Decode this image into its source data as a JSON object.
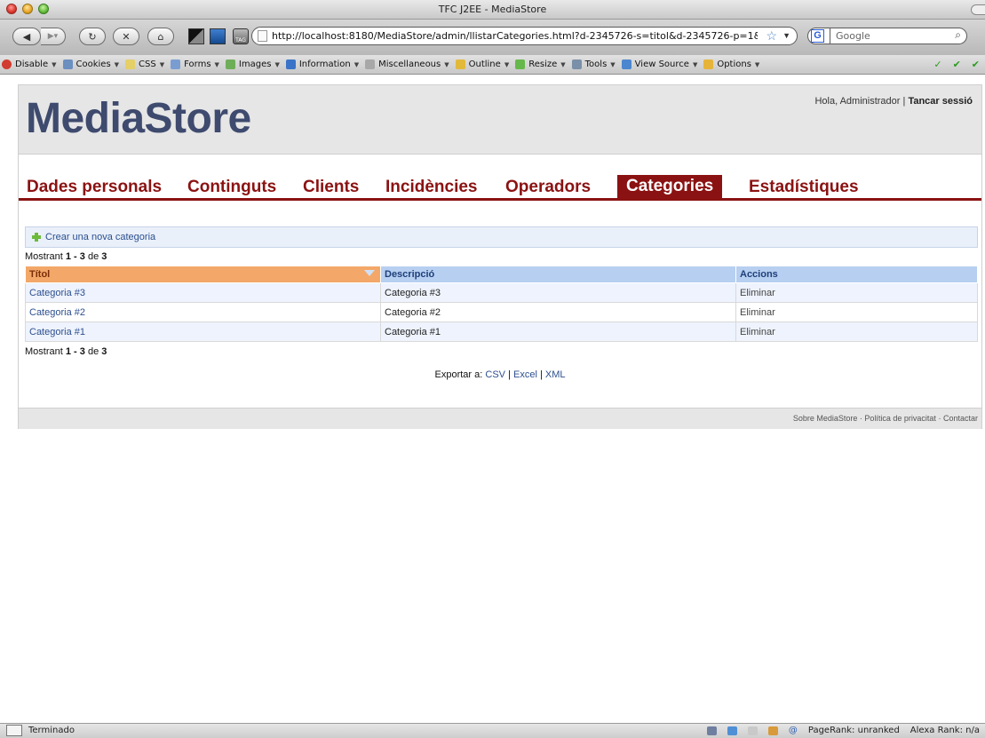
{
  "window": {
    "title": "TFC J2EE - MediaStore"
  },
  "navbar": {
    "url": "http://localhost:8180/MediaStore/admin/llistarCategories.html?d-2345726-s=titol&d-2345726-p=1&",
    "search_placeholder": "Google",
    "search_engine": "G"
  },
  "devbar": {
    "items": [
      {
        "label": "Disable",
        "icon": "disable-icon",
        "color": "#d23b2f"
      },
      {
        "label": "Cookies",
        "icon": "cookies-icon",
        "color": "#6b8fbf"
      },
      {
        "label": "CSS",
        "icon": "css-icon",
        "color": "#e5cf67"
      },
      {
        "label": "Forms",
        "icon": "forms-icon",
        "color": "#7a9dd1"
      },
      {
        "label": "Images",
        "icon": "images-icon",
        "color": "#6fae58"
      },
      {
        "label": "Information",
        "icon": "information-icon",
        "color": "#3a74c8"
      },
      {
        "label": "Miscellaneous",
        "icon": "miscellaneous-icon",
        "color": "#a8a8a8"
      },
      {
        "label": "Outline",
        "icon": "outline-icon",
        "color": "#e3b93a"
      },
      {
        "label": "Resize",
        "icon": "resize-icon",
        "color": "#66b84a"
      },
      {
        "label": "Tools",
        "icon": "tools-icon",
        "color": "#7a8fa8"
      },
      {
        "label": "View Source",
        "icon": "view-source-icon",
        "color": "#4c86cf"
      },
      {
        "label": "Options",
        "icon": "options-icon",
        "color": "#e6b43a"
      }
    ]
  },
  "header": {
    "logo": "MediaStore",
    "greeting": "Hola, Administrador",
    "separator": "|",
    "logout": "Tancar sessió"
  },
  "menu": {
    "items": [
      {
        "label": "Dades personals"
      },
      {
        "label": "Continguts"
      },
      {
        "label": "Clients"
      },
      {
        "label": "Incidències"
      },
      {
        "label": "Operadors"
      },
      {
        "label": "Categories",
        "active": true
      },
      {
        "label": "Estadístiques"
      }
    ]
  },
  "actions": {
    "create_label": "Crear una nova categoria"
  },
  "pagination": {
    "prefix": "Mostrant",
    "from": "1",
    "dash": "-",
    "to": "3",
    "of": "de",
    "total": "3"
  },
  "table": {
    "columns": [
      "Títol",
      "Descripció",
      "Accions"
    ],
    "rows": [
      {
        "title": "Categoria #3",
        "description": "Categoria #3",
        "action": "Eliminar"
      },
      {
        "title": "Categoria #2",
        "description": "Categoria #2",
        "action": "Eliminar"
      },
      {
        "title": "Categoria #1",
        "description": "Categoria #1",
        "action": "Eliminar"
      }
    ]
  },
  "export": {
    "label": "Exportar a:",
    "csv": "CSV",
    "excel": "Excel",
    "xml": "XML",
    "separator": "|"
  },
  "footer": {
    "about": "Sobre MediaStore",
    "privacy": "Política de privacitat",
    "contact": "Contactar",
    "separator": "·"
  },
  "statusbar": {
    "text": "Terminado",
    "pagerank": "PageRank: unranked",
    "alexa": "Alexa Rank: n/a"
  },
  "colors": {
    "brand": "#3e4a6e",
    "menu": "#8b1212",
    "sorted_header": "#f3a869",
    "header": "#b7cff0"
  }
}
